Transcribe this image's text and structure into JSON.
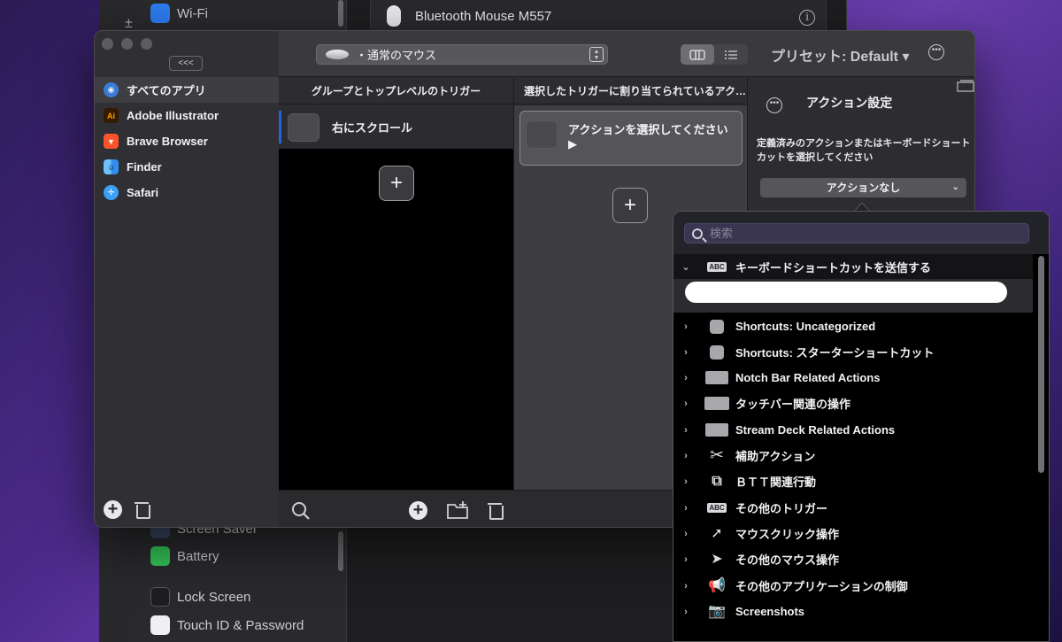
{
  "background_window": {
    "top_item": "Wi-Fi",
    "bottom_items": [
      "Screen Saver",
      "Battery",
      "Lock Screen",
      "Touch ID & Password"
    ],
    "device_name": "Bluetooth Mouse M557"
  },
  "btt": {
    "collapse_label": "<<<",
    "device_select": "・通常のマウス",
    "preset_label": "プリセット: Default ▾",
    "apps": [
      {
        "label": "すべてのアプリ",
        "icon": "globe-icon",
        "color": "#3a7bd5"
      },
      {
        "label": "Adobe Illustrator",
        "icon": "illustrator-icon",
        "color": "#331a00"
      },
      {
        "label": "Brave Browser",
        "icon": "brave-icon",
        "color": "#fb542b"
      },
      {
        "label": "Finder",
        "icon": "finder-icon",
        "color": "#2f8ef0"
      },
      {
        "label": "Safari",
        "icon": "safari-icon",
        "color": "#3aa0f5"
      }
    ],
    "columns": {
      "triggers_header": "グループとトップレベルのトリガー",
      "actions_header": "選択したトリガーに割り当てられているアク…"
    },
    "trigger_row_label": "右にスクロール",
    "action_card_label": "アクションを選択してください▶",
    "add_symbol": "+",
    "settings": {
      "title": "アクション設定",
      "description": "定義済みのアクションまたはキーボードショートカットを選択してください",
      "select_value": "アクションなし"
    }
  },
  "popup": {
    "search_placeholder": "検索",
    "expanded_section": "キーボードショートカットを送信する",
    "items": [
      {
        "label": "Shortcuts: Uncategorized",
        "icon": "square-icon"
      },
      {
        "label": "Shortcuts: スターターショートカット",
        "icon": "square-icon"
      },
      {
        "label": "Notch Bar Related Actions",
        "icon": "rectangle-icon"
      },
      {
        "label": "タッチバー関連の操作",
        "icon": "rectangle-icon"
      },
      {
        "label": "Stream Deck Related Actions",
        "icon": "rectangle-icon"
      },
      {
        "label": "補助アクション",
        "icon": "tools-icon"
      },
      {
        "label": "ＢＴＴ関連行動",
        "icon": "btt-icon"
      },
      {
        "label": "その他のトリガー",
        "icon": "abc-icon"
      },
      {
        "label": "マウスクリック操作",
        "icon": "cursor-click-icon"
      },
      {
        "label": "その他のマウス操作",
        "icon": "cursor-icon"
      },
      {
        "label": "その他のアプリケーションの制御",
        "icon": "megaphone-icon"
      },
      {
        "label": "Screenshots",
        "icon": "camera-icon"
      }
    ]
  }
}
